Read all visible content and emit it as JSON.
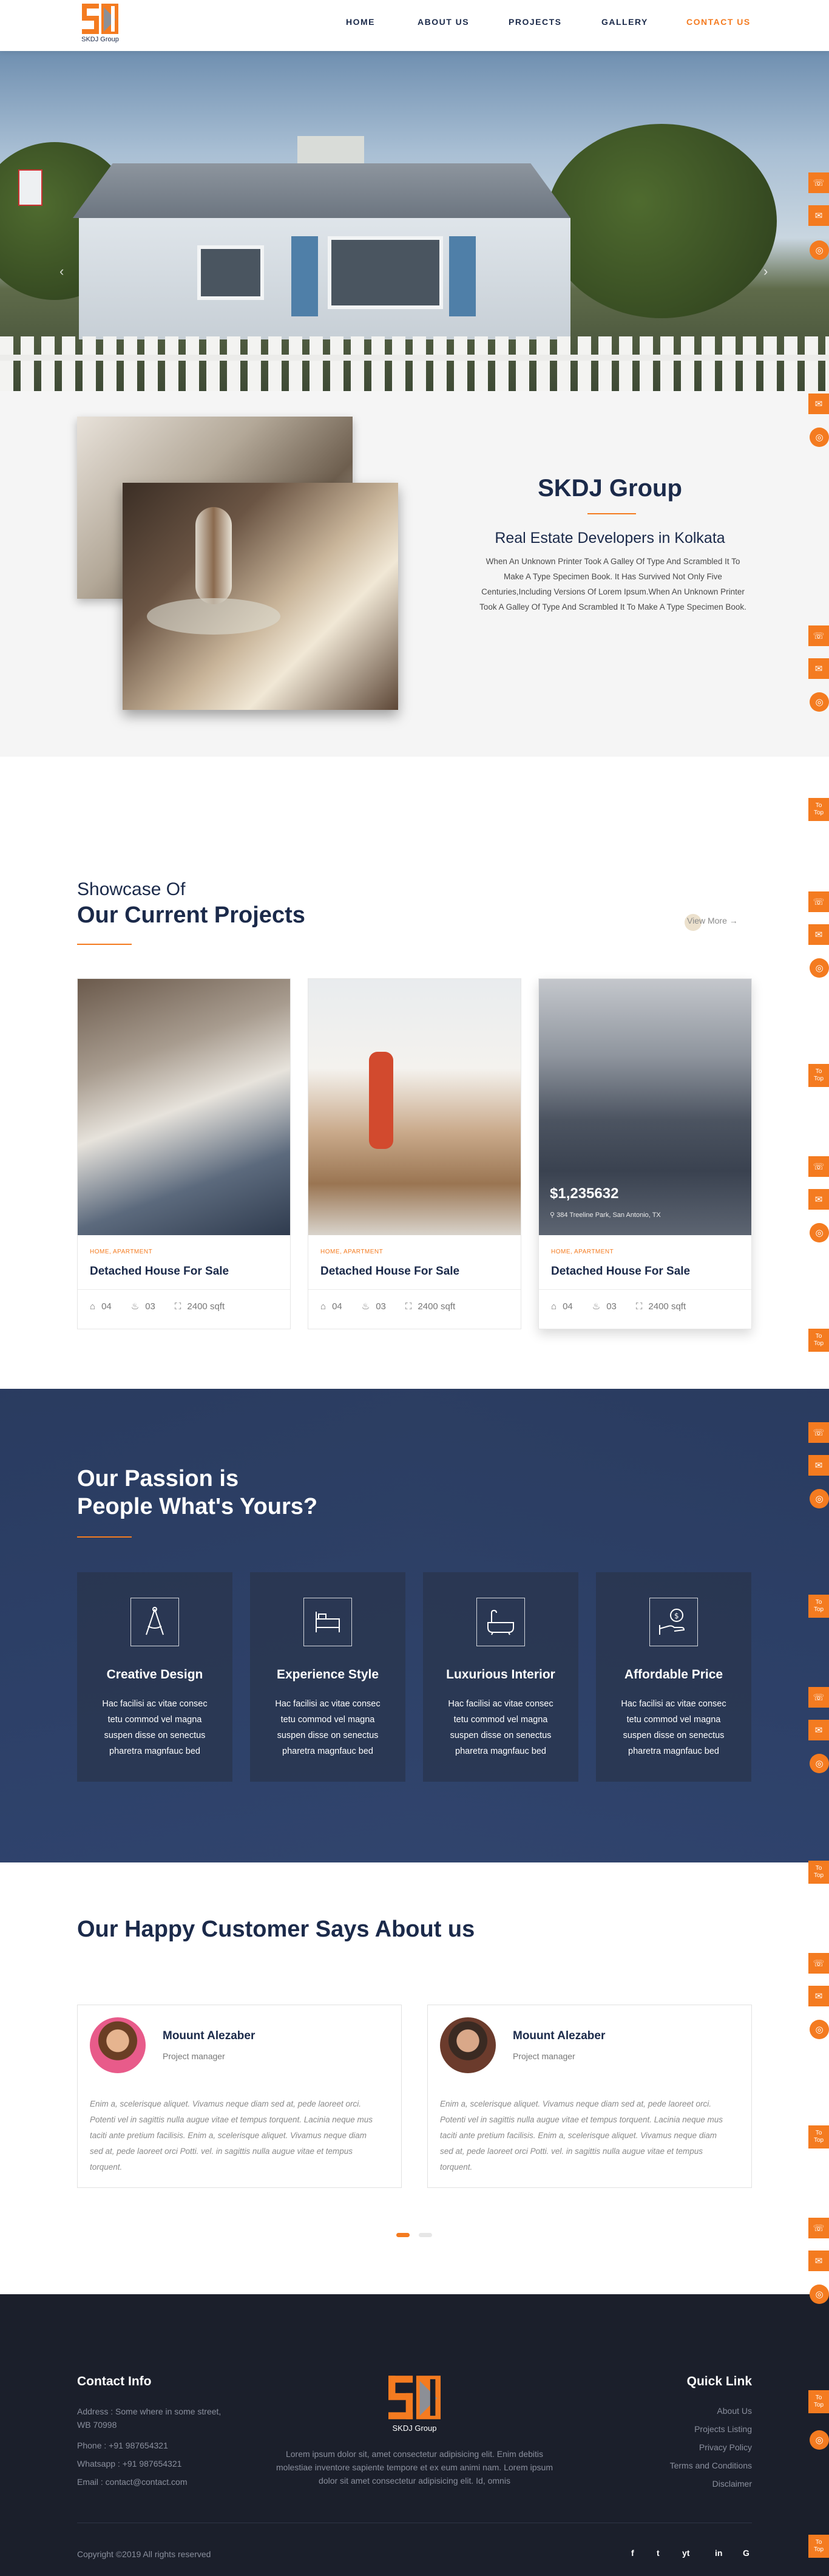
{
  "brand": {
    "logo_text": "SKDJ Group",
    "accent": "#f47b20",
    "navy": "#1b2a4a"
  },
  "nav": [
    {
      "label": "HOME"
    },
    {
      "label": "ABOUT US"
    },
    {
      "label": "PROJECTS"
    },
    {
      "label": "GALLERY"
    },
    {
      "label": "CONTACT US",
      "active": true
    }
  ],
  "about": {
    "title": "SKDJ Group",
    "subtitle": "Real Estate Developers in Kolkata",
    "body": "When An Unknown Printer Took A Galley Of Type And Scrambled It To Make A Type Specimen Book. It Has Survived Not Only Five Centuries,Including Versions Of Lorem Ipsum.When An Unknown Printer Took A Galley Of Type And Scrambled It To Make A Type Specimen Book."
  },
  "projects": {
    "pre_title": "Showcase Of",
    "title": "Our Current Projects",
    "view_more": "View More",
    "cards": [
      {
        "tag": "HOME, APARTMENT",
        "title": "Detached House For Sale",
        "beds": "04",
        "baths": "03",
        "area": "2400 sqft"
      },
      {
        "tag": "HOME, APARTMENT",
        "title": "Detached House For Sale",
        "beds": "04",
        "baths": "03",
        "area": "2400 sqft"
      },
      {
        "tag": "HOME, APARTMENT",
        "title": "Detached House For Sale",
        "beds": "04",
        "baths": "03",
        "area": "2400 sqft",
        "price": "$1,235632",
        "address": "384 Treeline Park, San Antonio, TX"
      }
    ]
  },
  "passion": {
    "title_line1": "Our Passion is",
    "title_line2": "People What's Yours?",
    "features": [
      {
        "title": "Creative Design",
        "body": "Hac facilisi ac vitae consec tetu commod vel magna suspen disse on senectus pharetra magnfauc bed",
        "icon": "drafting-compass-icon"
      },
      {
        "title": "Experience Style",
        "body": "Hac facilisi ac vitae consec tetu commod vel magna suspen disse on senectus pharetra magnfauc bed",
        "icon": "bed-icon"
      },
      {
        "title": "Luxurious Interior",
        "body": "Hac facilisi ac vitae consec tetu commod vel magna suspen disse on senectus pharetra magnfauc bed",
        "icon": "bathtub-icon"
      },
      {
        "title": "Affordable Price",
        "body": "Hac facilisi ac vitae consec tetu commod vel magna suspen disse on senectus pharetra magnfauc bed",
        "icon": "price-hand-icon"
      }
    ]
  },
  "testimonials": {
    "title": "Our Happy Customer Says About us",
    "items": [
      {
        "name": "Mouunt Alezaber",
        "role": "Project manager",
        "quote": "Enim a, scelerisque aliquet. Vivamus neque diam sed at, pede laoreet orci. Potenti vel in sagittis nulla augue vitae et tempus torquent. Lacinia neque mus taciti ante pretium facilisis. Enim a, scelerisque aliquet. Vivamus neque diam sed at, pede laoreet orci Potti. vel. in sagittis nulla augue vitae et tempus torquent."
      },
      {
        "name": "Mouunt Alezaber",
        "role": "Project manager",
        "quote": "Enim a, scelerisque aliquet. Vivamus neque diam sed at, pede laoreet orci. Potenti vel in sagittis nulla augue vitae et tempus torquent. Lacinia neque mus taciti ante pretium facilisis. Enim a, scelerisque aliquet. Vivamus neque diam sed at, pede laoreet orci Potti. vel. in sagittis nulla augue vitae et tempus torquent."
      }
    ]
  },
  "footer": {
    "contact_heading": "Contact Info",
    "address": "Address : Some where in some street, WB 70998",
    "phone": "Phone : +91 987654321",
    "whatsapp": "Whatsapp : +91 987654321",
    "email": "Email : contact@contact.com",
    "center_text": "Lorem ipsum dolor sit, amet consectetur adipisicing elit. Enim debitis molestiae inventore sapiente tempore et ex eum animi nam. Lorem ipsum dolor sit amet consectetur adipisicing elit. Id, omnis",
    "quick_heading": "Quick Link",
    "quick_links": [
      "About Us",
      "Projects Listing",
      "Privacy Policy",
      "Terms and Conditions",
      "Disclaimer"
    ],
    "copyright": "Copyright ©2019 All rights reserved",
    "social": [
      "f",
      "t",
      "yt",
      "in",
      "G"
    ]
  },
  "floating": {
    "top_label_1": "To",
    "top_label_2": "Top"
  }
}
